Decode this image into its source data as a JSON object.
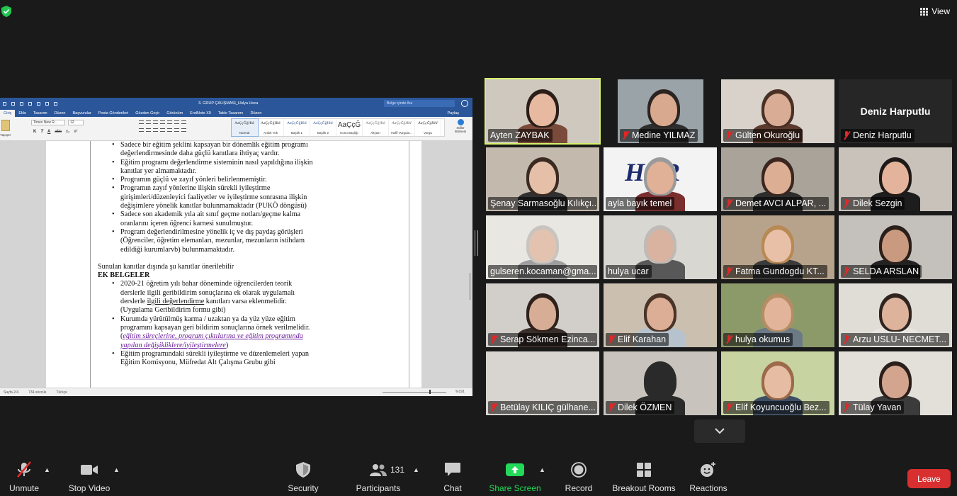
{
  "top": {
    "view_label": "View"
  },
  "word": {
    "doc_title": "3. GRUP ÇALIŞMASI_Hülya Hoca",
    "search_placeholder": "Belge içinde Ara",
    "tabs": [
      "Giriş",
      "Ekle",
      "Tasarım",
      "Düzen",
      "Başvurular",
      "Posta Gönderileri",
      "Gözden Geçir",
      "Görünüm",
      "EndNote X9",
      "Tablo Tasarımı",
      "Düzen"
    ],
    "share_label": "Paylaş",
    "paste_label": "Yapıştır",
    "font_name": "Times New R...",
    "font_size": "12",
    "format_buttons": [
      "K",
      "T",
      "A",
      "abc",
      "x₂",
      "x²"
    ],
    "styles": [
      {
        "sample": "AaÇçĞğHhI",
        "name": "Normal"
      },
      {
        "sample": "AaÇçĞğHhI",
        "name": "Aralık Yok"
      },
      {
        "sample": "AaÇçĞğHhI",
        "name": "Başlık 1"
      },
      {
        "sample": "AaÇçĞğHhI",
        "name": "Başlık 2"
      },
      {
        "sample": "AaÇçĞ",
        "name": "Konu Başlığı"
      },
      {
        "sample": "AaÇçĞğHhI",
        "name": "Altyazı"
      },
      {
        "sample": "AaÇçĞğHhI",
        "name": "Hafif Vurgula..."
      },
      {
        "sample": "AaÇçĞğHhI",
        "name": "Vurgu"
      }
    ],
    "styles_pane_label": "Stiller Bölmesi",
    "doc_bullets_1": [
      "Sadece bir eğitim şeklini kapsayan bir dönemlik eğitim programı değerlendirmesinde daha güçlü kanıtlara ihtiyaç vardır.",
      "Eğitim programı değerlendirme sisteminin nasıl yapıldığına ilişkin kanıtlar yer almamaktadır.",
      "Programın güçlü ve zayıf yönleri belirlenmemiştir.",
      "Programın zayıf yönlerine ilişkin sürekli iyileştirme girişimleri/düzenleyici faaliyetler ve iyileştirme sonrasına ilişkin değişimlere yönelik kanıtlar bulunmamaktadır (PUKÖ döngüsü)",
      "Sadece son akademik yıla ait sınıf geçme notları/geçme kalma oranlarını içeren öğrenci karnesi sunulmuştur.",
      "Program değerlendirilmesine yönelik iç ve dış paydaş görüşleri (Öğrenciler, öğretim elemanları, mezunlar, mezunların istihdam edildiği kurumlarvb) bulunmamaktadır."
    ],
    "doc_para": "Sunulan kanıtlar dışında şu kanıtlar önerilebilir",
    "doc_heading": "EK BELGELER",
    "doc_b2_1_pre": "2020-21 öğretim yılı bahar döneminde öğrencilerden teorik derslerle ilgili geribildirim sonuçlarına ek olarak uygulamalı derslerle ",
    "doc_b2_1_ul": "ilgili  değerlendirme",
    "doc_b2_1_post": " kanıtları varsa eklenmelidir. (Uygulama Geribildirim formu gibi)",
    "doc_b2_2_pre": "Kurumda yürütülmüş karma / uzaktan ya da yüz yüze eğitim programını kapsayan geri bildirim sonuçlarına örnek verilmelidir. (",
    "doc_b2_2_link": "eğitim süreçlerine, program çıktılarına ve eğitim programında yapılan değişikliklere/iyileştirmelere",
    "doc_b2_2_post": ")",
    "doc_b2_3": "Eğitim programındaki sürekli iyileştirme ve düzenlemeleri yapan Eğitim Komisyonu, Müfredat Alt Çalışma Grubu gibi",
    "status_page": "Sayfa 2/4",
    "status_words": "734 sözcük",
    "status_lang": "Türkçe",
    "zoom": "%191"
  },
  "participants": [
    {
      "name": "Ayten ZAYBAK",
      "muted": false,
      "active": true
    },
    {
      "name": "Medine YILMAZ",
      "muted": true,
      "active": false
    },
    {
      "name": "Gülten Okuroğlu",
      "muted": true,
      "active": false
    },
    {
      "name": "Deniz Harputlu",
      "muted": true,
      "active": false,
      "video_off": true
    },
    {
      "name": "Şenay Sarmasoğlu Kılıkçı...",
      "muted": false,
      "active": false
    },
    {
      "name": "ayla bayık temel",
      "muted": false,
      "active": false,
      "bg_text": "HER"
    },
    {
      "name": "Demet AVCI ALPAR, ...",
      "muted": true,
      "active": false
    },
    {
      "name": "Dilek Sezgin",
      "muted": true,
      "active": false
    },
    {
      "name": "gulseren.kocaman@gma...",
      "muted": false,
      "active": false
    },
    {
      "name": "hulya ucar",
      "muted": false,
      "active": false
    },
    {
      "name": "Fatma Gundogdu KT...",
      "muted": true,
      "active": false
    },
    {
      "name": "SELDA ARSLAN",
      "muted": true,
      "active": false
    },
    {
      "name": "Serap Sökmen Ezinca...",
      "muted": true,
      "active": false
    },
    {
      "name": "Elif Karahan",
      "muted": true,
      "active": false
    },
    {
      "name": "hulya okumus",
      "muted": true,
      "active": false
    },
    {
      "name": "Arzu USLU- NECMET...",
      "muted": true,
      "active": false
    },
    {
      "name": "Betülay KILIÇ gülhane...",
      "muted": true,
      "active": false
    },
    {
      "name": "Dilek ÖZMEN",
      "muted": true,
      "active": false
    },
    {
      "name": "Elif Koyuncuoğlu Bez...",
      "muted": true,
      "active": false
    },
    {
      "name": "Tülay Yavan",
      "muted": true,
      "active": false
    }
  ],
  "toolbar": {
    "unmute": "Unmute",
    "stop_video": "Stop Video",
    "security": "Security",
    "participants": "Participants",
    "participants_count": "131",
    "chat": "Chat",
    "share_screen": "Share Screen",
    "record": "Record",
    "breakout_rooms": "Breakout Rooms",
    "reactions": "Reactions",
    "leave": "Leave"
  },
  "colors": {
    "active_speaker_border": "#d5f26a",
    "share_green": "#23d959",
    "leave_red": "#d83030",
    "muted_red": "#e02828",
    "word_blue": "#2b579a"
  }
}
